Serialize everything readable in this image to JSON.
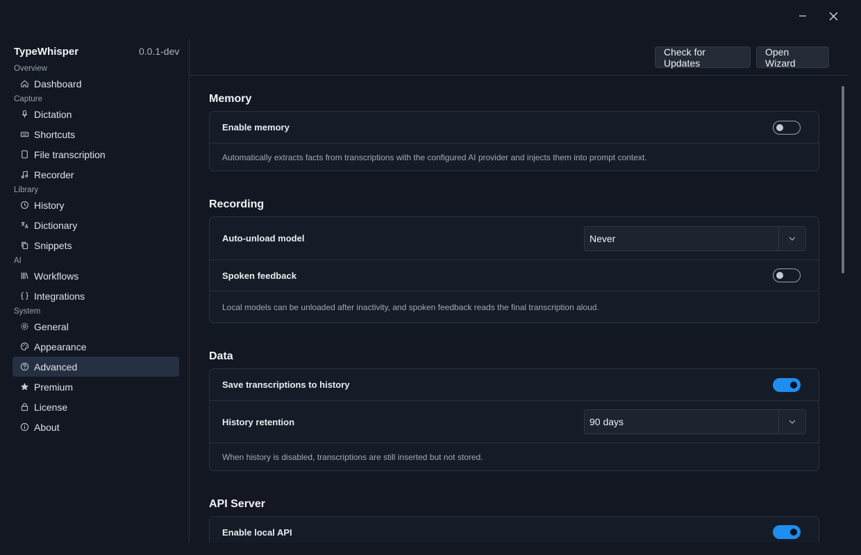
{
  "app": {
    "name": "TypeWhisper",
    "version": "0.0.1-dev"
  },
  "window": {
    "minimize_icon": "minimize-icon",
    "close_icon": "close-icon"
  },
  "header": {
    "check_updates": "Check for Updates",
    "open_wizard": "Open Wizard"
  },
  "sidebar": {
    "sections": [
      {
        "title": "Overview",
        "items": [
          {
            "label": "Dashboard",
            "icon": "home-icon"
          }
        ]
      },
      {
        "title": "Capture",
        "items": [
          {
            "label": "Dictation",
            "icon": "microphone-icon"
          },
          {
            "label": "Shortcuts",
            "icon": "keyboard-icon"
          },
          {
            "label": "File transcription",
            "icon": "file-icon"
          },
          {
            "label": "Recorder",
            "icon": "music-note-icon"
          }
        ]
      },
      {
        "title": "Library",
        "items": [
          {
            "label": "History",
            "icon": "history-icon"
          },
          {
            "label": "Dictionary",
            "icon": "translate-icon"
          },
          {
            "label": "Snippets",
            "icon": "copy-icon"
          }
        ]
      },
      {
        "title": "AI",
        "items": [
          {
            "label": "Workflows",
            "icon": "library-icon"
          },
          {
            "label": "Integrations",
            "icon": "braces-icon"
          }
        ]
      },
      {
        "title": "System",
        "items": [
          {
            "label": "General",
            "icon": "gear-icon"
          },
          {
            "label": "Appearance",
            "icon": "palette-icon"
          },
          {
            "label": "Advanced",
            "icon": "help-circle-icon",
            "active": true
          },
          {
            "label": "Premium",
            "icon": "star-icon"
          },
          {
            "label": "License",
            "icon": "lock-icon"
          },
          {
            "label": "About",
            "icon": "info-icon"
          }
        ]
      }
    ]
  },
  "memory": {
    "title": "Memory",
    "enable_label": "Enable memory",
    "enable_on": false,
    "description": "Automatically extracts facts from transcriptions with the configured AI provider and injects them into prompt context."
  },
  "recording": {
    "title": "Recording",
    "auto_unload_label": "Auto-unload model",
    "auto_unload_value": "Never",
    "spoken_feedback_label": "Spoken feedback",
    "spoken_feedback_on": false,
    "description": "Local models can be unloaded after inactivity, and spoken feedback reads the final transcription aloud."
  },
  "data": {
    "title": "Data",
    "save_history_label": "Save transcriptions to history",
    "save_history_on": true,
    "retention_label": "History retention",
    "retention_value": "90 days",
    "description": "When history is disabled, transcriptions are still inserted but not stored."
  },
  "api_server": {
    "title": "API Server",
    "enable_label": "Enable local API",
    "enable_on": true
  },
  "colors": {
    "accent": "#1e8ef0",
    "background": "#121722",
    "card": "#161c27"
  }
}
